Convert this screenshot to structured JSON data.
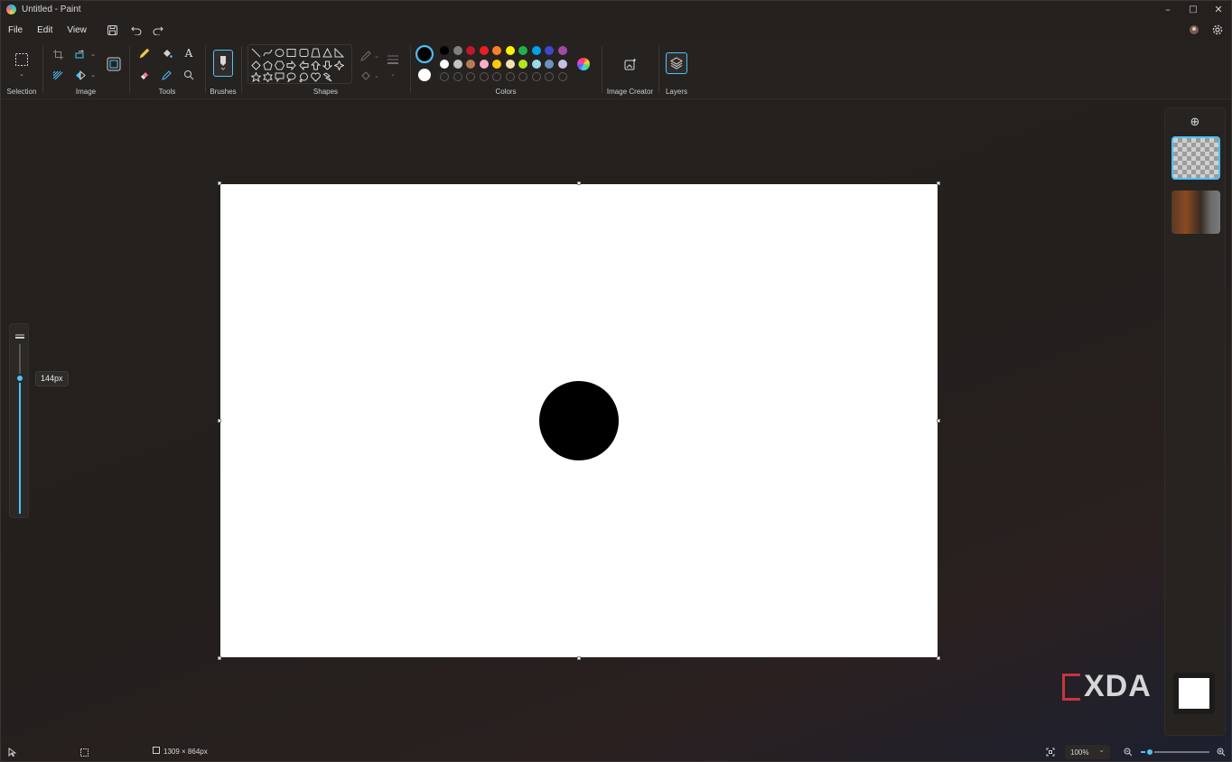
{
  "window": {
    "title": "Untitled - Paint",
    "minimize": "–",
    "maximize": "□",
    "close": "✕"
  },
  "menu": {
    "items": [
      "File",
      "Edit",
      "View"
    ]
  },
  "ribbon": {
    "groups": {
      "selection": "Selection",
      "image": "Image",
      "tools": "Tools",
      "brushes": "Brushes",
      "shapes": "Shapes",
      "colors": "Colors",
      "image_creator": "Image Creator",
      "layers": "Layers"
    },
    "tools": {
      "text_glyph": "A"
    },
    "colors": {
      "primary": "#000000",
      "secondary": "#ffffff",
      "palette_row1": [
        "#000000",
        "#7f7f7f",
        "#c0172b",
        "#ed1c24",
        "#ff7f27",
        "#fff200",
        "#22b14c",
        "#00a2e8",
        "#3f48cc",
        "#a349a4"
      ],
      "palette_row2": [
        "#ffffff",
        "#c3c3c3",
        "#b97a57",
        "#ffaec9",
        "#ffc90e",
        "#efe4b0",
        "#b5e61d",
        "#99d9ea",
        "#7092be",
        "#c8bfe7"
      ]
    }
  },
  "brush_size": {
    "label": "144px",
    "level": 0.8
  },
  "canvas": {
    "background": "#ffffff",
    "shape": "black circle"
  },
  "layers_panel": {
    "add_glyph": "⊕"
  },
  "watermark": {
    "text": "XDA"
  },
  "status": {
    "dimensions": "1309 × 864px",
    "zoom": "100%",
    "zoom_level": 0.13
  }
}
